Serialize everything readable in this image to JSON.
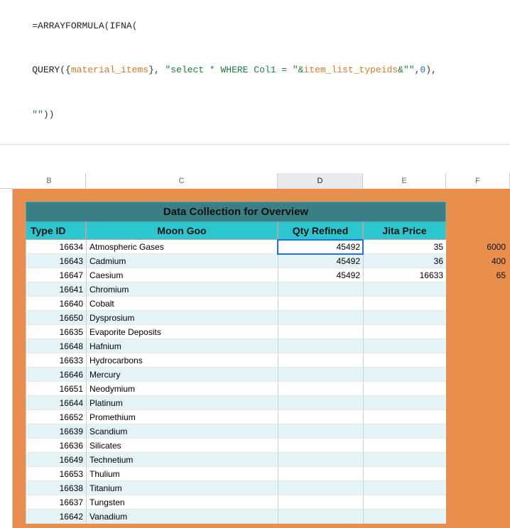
{
  "formula": {
    "line1_pre": "=",
    "line1_fn1": "ARRAYFORMULA",
    "line1_p1": "(",
    "line1_fn2": "IFNA",
    "line1_p2": "(",
    "line2_fn": "QUERY",
    "line2_p1": "({",
    "line2_ref": "material_items",
    "line2_p2": "}, ",
    "line2_str1": "\"select * WHERE Col1 = \"",
    "line2_amp1": "&",
    "line2_ref2": "item_list_typeids",
    "line2_amp2": "&",
    "line2_str2": "\"\"",
    "line2_p3": ",",
    "line2_num": "0",
    "line2_p4": "),",
    "line3_str": "\"\"",
    "line3_p": "))"
  },
  "columns": {
    "b": "B",
    "c": "C",
    "d": "D",
    "e": "E",
    "f": "F"
  },
  "panel": {
    "title": "Data Collection for Overview",
    "h_typeid": "Type ID",
    "h_name": "Moon Goo",
    "h_qty": "Qty Refined",
    "h_price": "Jita Price"
  },
  "rows": [
    {
      "id": "16634",
      "name": "Atmospheric Gases",
      "qty": "45492",
      "price": "35",
      "f": "6000"
    },
    {
      "id": "16643",
      "name": "Cadmium",
      "qty": "45492",
      "price": "36",
      "f": "400"
    },
    {
      "id": "16647",
      "name": "Caesium",
      "qty": "45492",
      "price": "16633",
      "f": "65"
    },
    {
      "id": "16641",
      "name": "Chromium",
      "qty": "",
      "price": "",
      "f": ""
    },
    {
      "id": "16640",
      "name": "Cobalt",
      "qty": "",
      "price": "",
      "f": ""
    },
    {
      "id": "16650",
      "name": "Dysprosium",
      "qty": "",
      "price": "",
      "f": ""
    },
    {
      "id": "16635",
      "name": "Evaporite Deposits",
      "qty": "",
      "price": "",
      "f": ""
    },
    {
      "id": "16648",
      "name": "Hafnium",
      "qty": "",
      "price": "",
      "f": ""
    },
    {
      "id": "16633",
      "name": "Hydrocarbons",
      "qty": "",
      "price": "",
      "f": ""
    },
    {
      "id": "16646",
      "name": "Mercury",
      "qty": "",
      "price": "",
      "f": ""
    },
    {
      "id": "16651",
      "name": "Neodymium",
      "qty": "",
      "price": "",
      "f": ""
    },
    {
      "id": "16644",
      "name": "Platinum",
      "qty": "",
      "price": "",
      "f": ""
    },
    {
      "id": "16652",
      "name": "Promethium",
      "qty": "",
      "price": "",
      "f": ""
    },
    {
      "id": "16639",
      "name": "Scandium",
      "qty": "",
      "price": "",
      "f": ""
    },
    {
      "id": "16636",
      "name": "Silicates",
      "qty": "",
      "price": "",
      "f": ""
    },
    {
      "id": "16649",
      "name": "Technetium",
      "qty": "",
      "price": "",
      "f": ""
    },
    {
      "id": "16653",
      "name": "Thulium",
      "qty": "",
      "price": "",
      "f": ""
    },
    {
      "id": "16638",
      "name": "Titanium",
      "qty": "",
      "price": "",
      "f": ""
    },
    {
      "id": "16637",
      "name": "Tungsten",
      "qty": "",
      "price": "",
      "f": ""
    },
    {
      "id": "16642",
      "name": "Vanadium",
      "qty": "",
      "price": "",
      "f": ""
    }
  ]
}
